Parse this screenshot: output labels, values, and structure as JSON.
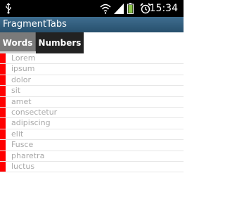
{
  "status_bar": {
    "time": "15:34",
    "icons": [
      "usb-icon",
      "wifi-icon",
      "signal-icon",
      "battery-icon",
      "alarm-icon"
    ]
  },
  "app": {
    "title": "FragmentTabs"
  },
  "tabs": [
    {
      "label": "Words",
      "selected": true
    },
    {
      "label": "Numbers",
      "selected": false
    }
  ],
  "list": {
    "items": [
      "Lorem",
      "ipsum",
      "dolor",
      "sit",
      "amet",
      "consectetur",
      "adipiscing",
      "elit",
      "Fusce",
      "pharetra",
      "luctus"
    ]
  },
  "colors": {
    "status_bar_bg": "#000000",
    "title_bar_bg": "#3f6d8f",
    "selected_tab_bg": "#7a7a7a",
    "unselected_tab_bg": "#222222",
    "item_marker": "#ff0000",
    "item_text": "#a9a9a9"
  }
}
